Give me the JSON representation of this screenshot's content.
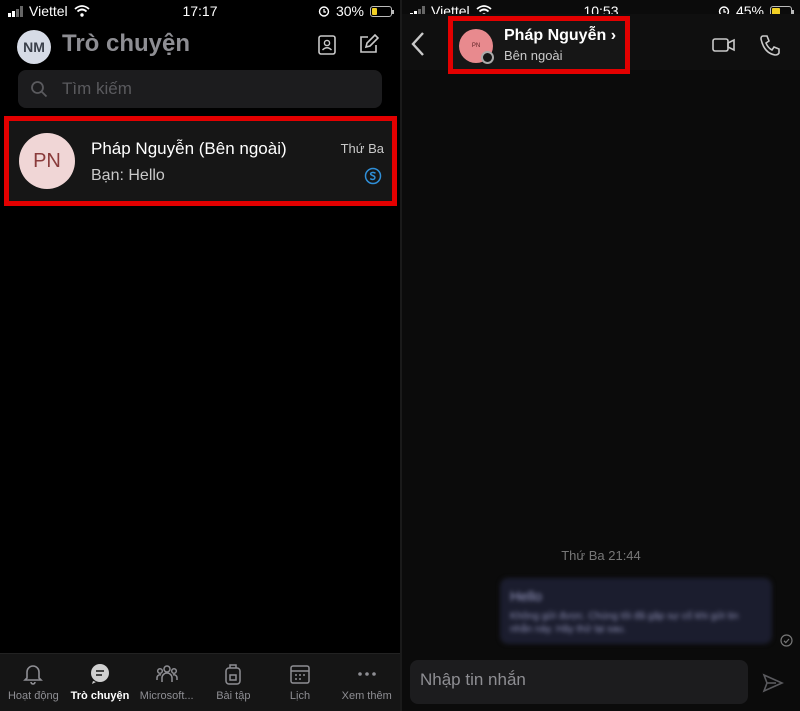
{
  "left": {
    "status": {
      "carrier": "Viettel",
      "time": "17:17",
      "battery": "30%",
      "battery_level": 0.3
    },
    "header": {
      "avatar_initials": "NM",
      "title": "Trò chuyện"
    },
    "search": {
      "placeholder": "Tìm kiếm"
    },
    "chat": {
      "initials": "PN",
      "name": "Pháp Nguyễn (Bên ngoài)",
      "preview": "Bạn: Hello",
      "date": "Thứ Ba"
    },
    "nav": [
      {
        "label": "Hoạt động",
        "icon": "bell-icon"
      },
      {
        "label": "Trò chuyện",
        "icon": "chat-icon"
      },
      {
        "label": "Microsoft...",
        "icon": "teams-icon"
      },
      {
        "label": "Bài tập",
        "icon": "backpack-icon"
      },
      {
        "label": "Lịch",
        "icon": "calendar-icon"
      },
      {
        "label": "Xem thêm",
        "icon": "more-icon"
      }
    ]
  },
  "right": {
    "status": {
      "carrier": "Viettel",
      "time": "10:53",
      "battery": "45%",
      "battery_level": 0.45
    },
    "contact": {
      "initials": "PN",
      "name": "Pháp Nguyễn",
      "subtitle": "Bên ngoài"
    },
    "message": {
      "date": "Thứ Ba 21:44",
      "text": "Hello",
      "notice": "Không gửi được. Chúng tôi đã gặp sự cố khi gửi tin nhắn này. Hãy thử lại sau."
    },
    "composer": {
      "placeholder": "Nhập tin nhắn"
    }
  },
  "colors": {
    "highlight": "#e30000",
    "accent_blue": "#2f8fd8",
    "muted": "#8e8e93"
  }
}
